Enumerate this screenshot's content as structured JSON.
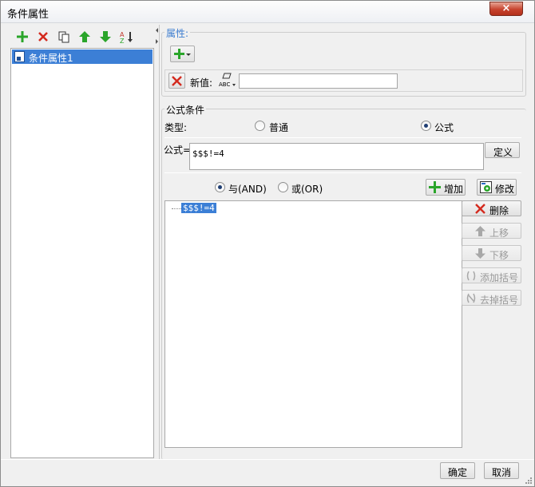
{
  "window": {
    "title": "条件属性",
    "close_glyph": "×"
  },
  "left_toolbar": {
    "icons": [
      "add-icon",
      "delete-icon",
      "copy-icon",
      "move-up-icon",
      "move-down-icon",
      "sort-icon"
    ]
  },
  "left_list": {
    "items": [
      {
        "label": "条件属性1",
        "selected": true
      }
    ]
  },
  "attributes": {
    "group_title": "属性:",
    "add_dropdown_icon": "add-dropdown-icon",
    "new_value_label": "新值:",
    "new_value": ""
  },
  "formula_condition": {
    "group_title": "公式条件",
    "type_label": "类型:",
    "type_options": [
      {
        "label": "普通",
        "selected": false
      },
      {
        "label": "公式",
        "selected": true
      }
    ],
    "formula_label": "公式=",
    "formula_value": "$$$!=4",
    "define_button": "定义",
    "logic_options": [
      {
        "label": "与(AND)",
        "selected": true
      },
      {
        "label": "或(OR)",
        "selected": false
      }
    ],
    "add_button": "增加",
    "modify_button": "修改",
    "tree_items": [
      "$$$!=4"
    ],
    "side_buttons": {
      "delete": "删除",
      "move_up": "上移",
      "move_down": "下移",
      "add_bracket": "添加括号",
      "remove_bracket": "去掉括号"
    }
  },
  "footer": {
    "ok": "确定",
    "cancel": "取消"
  },
  "colors": {
    "selection": "#3c7fd6",
    "group_title_blue": "#3b7ccf",
    "green": "#2aa52a",
    "red": "#d42a1e"
  }
}
